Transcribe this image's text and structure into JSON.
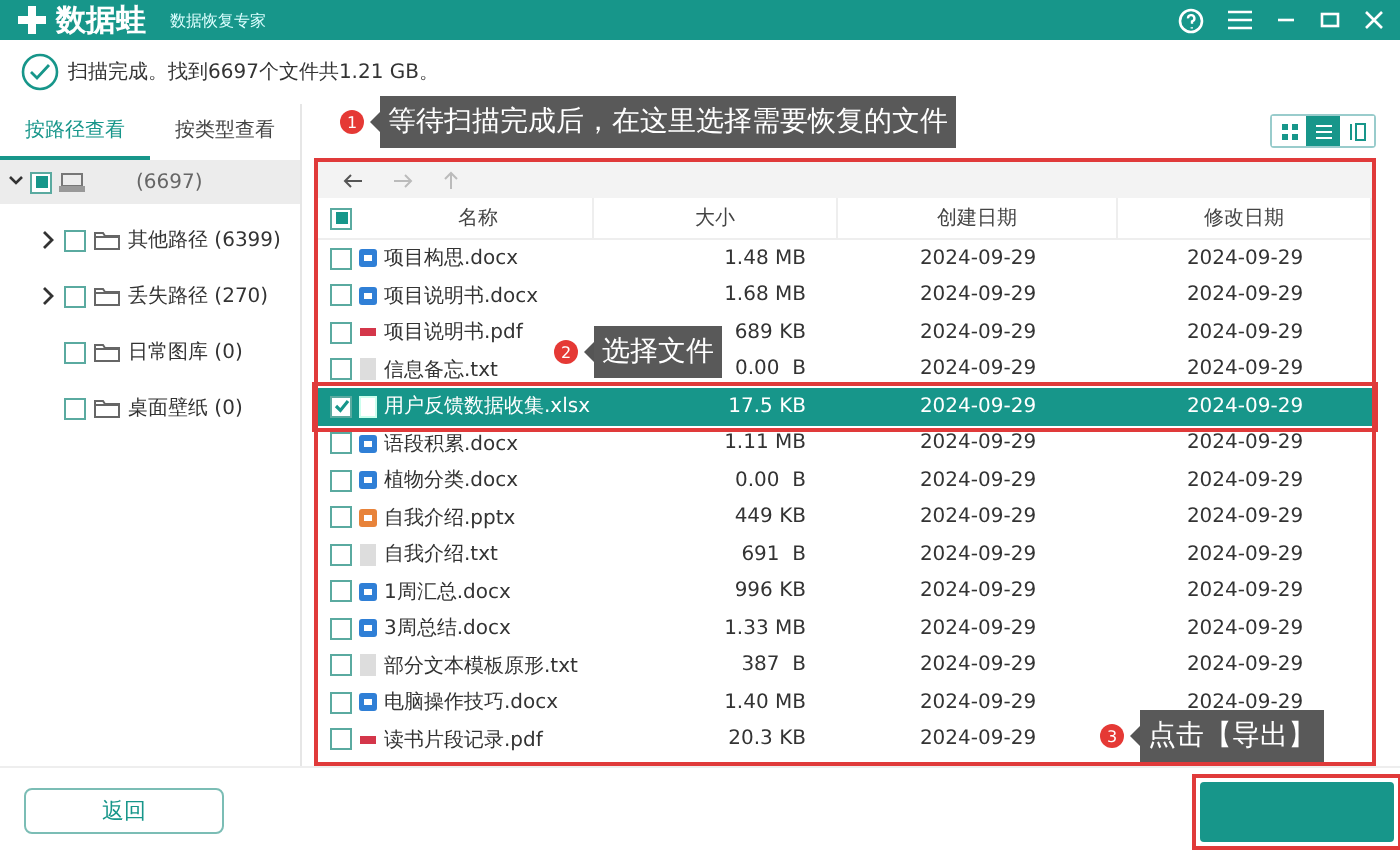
{
  "app": {
    "name": "数据蛙",
    "subtitle": "数据恢复专家"
  },
  "status": "扫描完成。找到6697个文件共1.21 GB。",
  "tabs": [
    {
      "label": "按路径查看",
      "selected": true
    },
    {
      "label": "按类型查看",
      "selected": false
    }
  ],
  "tree": {
    "count": "(6697)",
    "indeterminate": true,
    "expanded": true,
    "selected": true,
    "children": [
      {
        "label": "其他路径 (6399)",
        "checked": false,
        "expandable": true
      },
      {
        "label": "丢失路径 (270)",
        "checked": false,
        "expandable": true
      },
      {
        "label": "日常图库 (0)",
        "checked": false,
        "expandable": false
      },
      {
        "label": "桌面壁纸 (0)",
        "checked": false,
        "expandable": false
      }
    ]
  },
  "view_modes": [
    {
      "kind": "grid",
      "selected": false
    },
    {
      "kind": "list",
      "selected": true
    },
    {
      "kind": "columns",
      "selected": false
    }
  ],
  "table": {
    "highlighted": true,
    "header_indeterminate": true,
    "columns": [
      "名称",
      "大小",
      "创建日期",
      "修改日期"
    ],
    "rows": [
      {
        "name": "项目构思.docx",
        "kind": "word",
        "size": "1.48 MB",
        "created": "2024-09-29",
        "modified": "2024-09-29",
        "checked": false,
        "selected": false,
        "highlighted": false
      },
      {
        "name": "项目说明书.docx",
        "kind": "word",
        "size": "1.68 MB",
        "created": "2024-09-29",
        "modified": "2024-09-29",
        "checked": false,
        "selected": false,
        "highlighted": false
      },
      {
        "name": "项目说明书.pdf",
        "kind": "pdf",
        "size": "689 KB",
        "created": "2024-09-29",
        "modified": "2024-09-29",
        "checked": false,
        "selected": false,
        "highlighted": false
      },
      {
        "name": "信息备忘.txt",
        "kind": "text",
        "size": "0.00  B",
        "created": "2024-09-29",
        "modified": "2024-09-29",
        "checked": false,
        "selected": false,
        "highlighted": false
      },
      {
        "name": "用户反馈数据收集.xlsx",
        "kind": "sheet",
        "size": "17.5 KB",
        "created": "2024-09-29",
        "modified": "2024-09-29",
        "checked": true,
        "selected": true,
        "highlighted": true
      },
      {
        "name": "语段积累.docx",
        "kind": "word",
        "size": "1.11 MB",
        "created": "2024-09-29",
        "modified": "2024-09-29",
        "checked": false,
        "selected": false,
        "highlighted": false
      },
      {
        "name": "植物分类.docx",
        "kind": "word",
        "size": "0.00  B",
        "created": "2024-09-29",
        "modified": "2024-09-29",
        "checked": false,
        "selected": false,
        "highlighted": false
      },
      {
        "name": "自我介绍.pptx",
        "kind": "slides",
        "size": "449 KB",
        "created": "2024-09-29",
        "modified": "2024-09-29",
        "checked": false,
        "selected": false,
        "highlighted": false
      },
      {
        "name": "自我介绍.txt",
        "kind": "text",
        "size": "691  B",
        "created": "2024-09-29",
        "modified": "2024-09-29",
        "checked": false,
        "selected": false,
        "highlighted": false
      },
      {
        "name": "1周汇总.docx",
        "kind": "word",
        "size": "996 KB",
        "created": "2024-09-29",
        "modified": "2024-09-29",
        "checked": false,
        "selected": false,
        "highlighted": false
      },
      {
        "name": "3周总结.docx",
        "kind": "word",
        "size": "1.33 MB",
        "created": "2024-09-29",
        "modified": "2024-09-29",
        "checked": false,
        "selected": false,
        "highlighted": false
      },
      {
        "name": "部分文本模板原形.txt",
        "kind": "text",
        "size": "387  B",
        "created": "2024-09-29",
        "modified": "2024-09-29",
        "checked": false,
        "selected": false,
        "highlighted": false
      },
      {
        "name": "电脑操作技巧.docx",
        "kind": "word",
        "size": "1.40 MB",
        "created": "2024-09-29",
        "modified": "2024-09-29",
        "checked": false,
        "selected": false,
        "highlighted": false
      },
      {
        "name": "读书片段记录.pdf",
        "kind": "pdf",
        "size": "20.3 KB",
        "created": "2024-09-29",
        "checked": false,
        "selected": false,
        "highlighted": false
      }
    ]
  },
  "callouts": [
    {
      "number": "1",
      "text": "等待扫描完成后，在这里选择需要恢复的文件"
    },
    {
      "number": "2",
      "text": "选择文件"
    },
    {
      "number": "3",
      "text": "点击【导出】"
    }
  ],
  "buttons": {
    "back": "返回",
    "export_highlighted": true
  }
}
